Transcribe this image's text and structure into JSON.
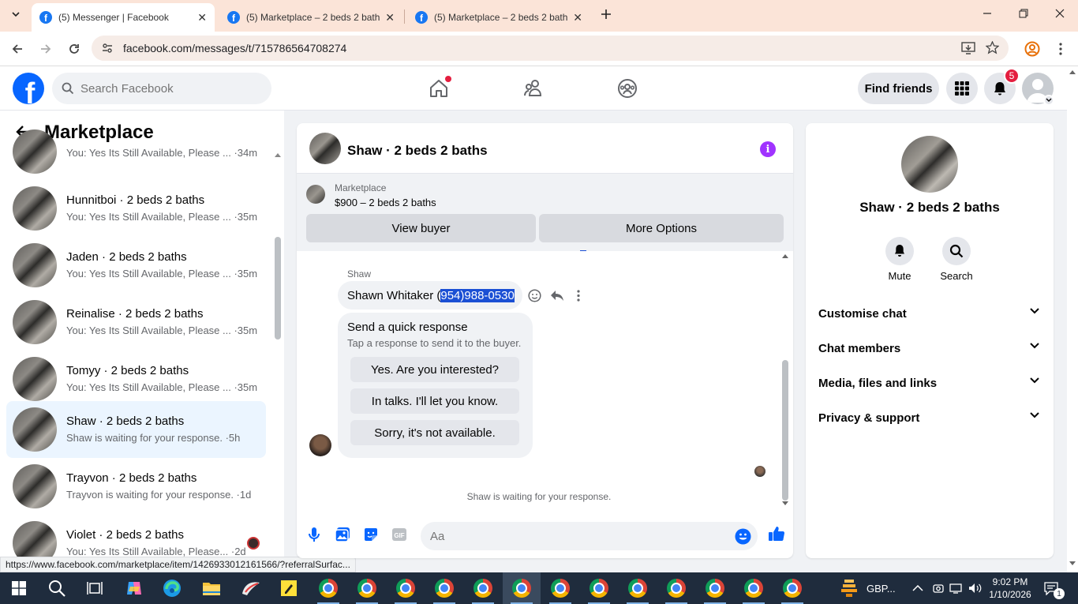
{
  "browser": {
    "tabs": [
      {
        "title": "(5) Messenger | Facebook",
        "active": true
      },
      {
        "title": "(5) Marketplace – 2 beds 2 bath",
        "active": false
      },
      {
        "title": "(5) Marketplace – 2 beds 2 bath",
        "active": false
      }
    ],
    "url": "facebook.com/messages/t/715786564708274",
    "status_url": "https://www.facebook.com/marketplace/item/1426933012161566/?referralSurfac..."
  },
  "header": {
    "search_placeholder": "Search Facebook",
    "find_friends": "Find friends",
    "notification_count": "5",
    "brand_color": "#0866ff",
    "badge_color": "#e41e3f"
  },
  "sidebar": {
    "title": "Marketplace",
    "conversations": [
      {
        "name": "",
        "preview": "You: Yes Its Still Available, Please ... ·34m",
        "selected": false
      },
      {
        "name": "Hunnitboi · 2 beds 2 baths",
        "preview": "You: Yes Its Still Available, Please ... ·35m",
        "selected": false
      },
      {
        "name": "Jaden · 2 beds 2 baths",
        "preview": "You: Yes Its Still Available, Please ... ·35m",
        "selected": false
      },
      {
        "name": "Reinalise · 2 beds 2 baths",
        "preview": "You: Yes Its Still Available, Please ... ·35m",
        "selected": false
      },
      {
        "name": "Tomyy · 2 beds 2 baths",
        "preview": "You: Yes Its Still Available, Please ... ·35m",
        "selected": false
      },
      {
        "name": "Shaw · 2 beds 2 baths",
        "preview": "Shaw is waiting for your response. ·5h",
        "selected": true
      },
      {
        "name": "Trayvon · 2 beds 2 baths",
        "preview": "Trayvon is waiting for your response. ·1d",
        "selected": false
      },
      {
        "name": "Violet · 2 beds 2 baths",
        "preview": "You: Yes Its Still Available, Please... ·2d",
        "selected": false
      }
    ]
  },
  "chat": {
    "title": "Shaw · 2 beds 2 baths",
    "marketplace_label": "Marketplace",
    "listing": "$900 – 2 beds 2 baths",
    "view_buyer": "View buyer",
    "more_options": "More Options",
    "sender": "Shaw",
    "message_prefix": "Shawn Whitaker (",
    "message_phone": "954)988-0530",
    "quick_title": "Send a quick response",
    "quick_subtitle": "Tap a response to send it to the buyer.",
    "quick_responses": [
      "Yes. Are you interested?",
      "In talks. I'll let you know.",
      "Sorry, it's not available."
    ],
    "waiting": "Shaw is waiting for your response.",
    "input_placeholder": "Aa"
  },
  "info_panel": {
    "name": "Shaw · 2 beds 2 baths",
    "mute": "Mute",
    "search": "Search",
    "sections": [
      "Customise chat",
      "Chat members",
      "Media, files and links",
      "Privacy & support"
    ]
  },
  "taskbar": {
    "weather": "GBP...",
    "time": "9:02 PM",
    "date": "1/10/2026",
    "notif_count": "1"
  }
}
